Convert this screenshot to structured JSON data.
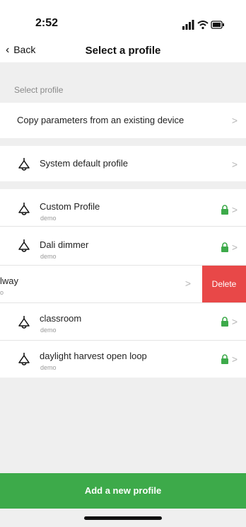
{
  "status": {
    "time": "2:52"
  },
  "nav": {
    "back_label": "Back",
    "title": "Select a profile"
  },
  "section_label": "Select profile",
  "copy_row": {
    "label": "Copy parameters from an existing device"
  },
  "default_row": {
    "label": "System default profile"
  },
  "profiles": [
    {
      "name": "Custom Profile",
      "sub": "demo",
      "locked": true
    },
    {
      "name": "Dali dimmer",
      "sub": "demo",
      "locked": true
    },
    {
      "name": "lway",
      "sub": "o",
      "locked": false
    },
    {
      "name": "classroom",
      "sub": "demo",
      "locked": true
    },
    {
      "name": "daylight harvest open loop",
      "sub": "demo",
      "locked": true
    }
  ],
  "delete_label": "Delete",
  "add_button": "Add a new profile",
  "colors": {
    "accent_green": "#3daa4a",
    "delete_red": "#e84848",
    "lock_green": "#3daa4a"
  },
  "icons": {
    "chevron": ">",
    "lamp": "lamp-icon",
    "lock": "lock-icon"
  }
}
